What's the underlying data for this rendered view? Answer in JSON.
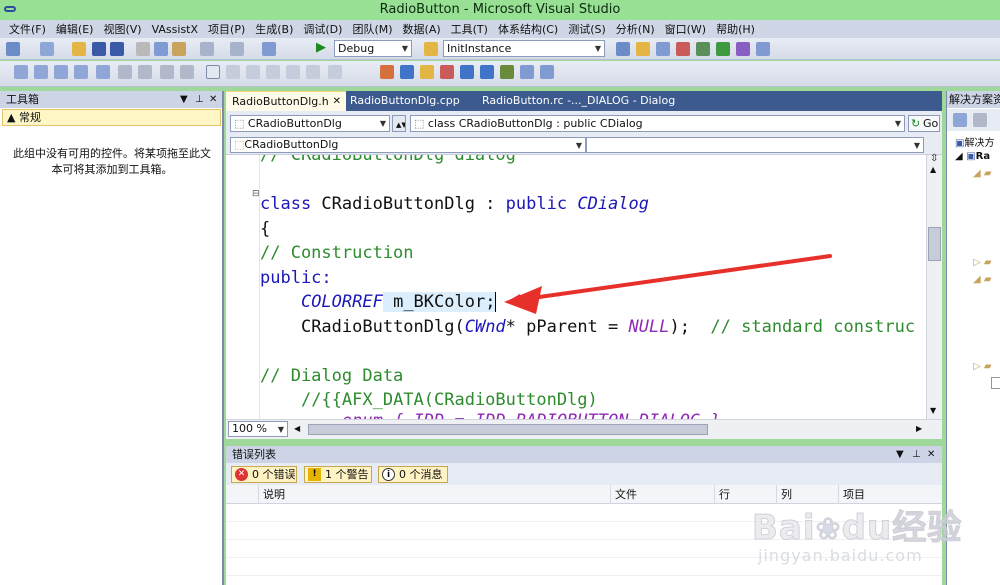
{
  "window": {
    "title": "RadioButton - Microsoft Visual Studio"
  },
  "menu": [
    "文件(F)",
    "编辑(E)",
    "视图(V)",
    "VAssistX",
    "项目(P)",
    "生成(B)",
    "调试(D)",
    "团队(M)",
    "数据(A)",
    "工具(T)",
    "体系结构(C)",
    "测试(S)",
    "分析(N)",
    "窗口(W)",
    "帮助(H)"
  ],
  "toolbar": {
    "config": "Debug",
    "find_text": "InitInstance"
  },
  "toolbox": {
    "title": "工具箱",
    "category": "▲ 常规",
    "empty_text": "此组中没有可用的控件。将某项拖至此文本可将其添加到工具箱。"
  },
  "tabs": [
    {
      "label": "RadioButtonDlg.h",
      "active": true
    },
    {
      "label": "RadioButtonDlg.cpp",
      "active": false
    },
    {
      "label": "RadioButton.rc -..._DIALOG - Dialog",
      "active": false
    }
  ],
  "nav": {
    "class_combo": "CRadioButtonDlg",
    "member_combo": "class CRadioButtonDlg : public CDialog",
    "go_label": "Go",
    "scope_combo": "CRadioButtonDlg"
  },
  "code": {
    "l0": "// CRadioButtonDlg dialog",
    "l1a": "class",
    "l1b": " CRadioButtonDlg : ",
    "l1c": "public",
    "l1d": "CDialog",
    "l2": "{",
    "l3": "// Construction",
    "l4": "public:",
    "l5a": "COLORREF",
    "l5b": " m_BKColor;",
    "l6a": "CRadioButtonDlg(",
    "l6b": "CWnd",
    "l6c": "* pParent = ",
    "l6d": "NULL",
    "l6e": ");  ",
    "l6f": "// standard construc",
    "l7": "",
    "l8": "// Dialog Data",
    "l9": "//{{AFX_DATA(CRadioButtonDlg)",
    "l10": "enum { IDD = IDD_RADIOBUTTON_DIALOG }"
  },
  "zoom": "100 %",
  "errors": {
    "title": "错误列表",
    "errors_btn": "0 个错误",
    "warnings_btn": "1 个警告",
    "messages_btn": "0 个消息",
    "columns": [
      "说明",
      "文件",
      "行",
      "列",
      "项目"
    ]
  },
  "solution": {
    "title": "解决方案资",
    "item": "解决方",
    "proj": "Ra"
  },
  "watermark": {
    "brand": "Bai",
    "brand2": "du",
    "cn": "经验",
    "url": "jingyan.baidu.com"
  },
  "colors": {
    "accent": "#97e094",
    "arrow": "#e8302b"
  }
}
